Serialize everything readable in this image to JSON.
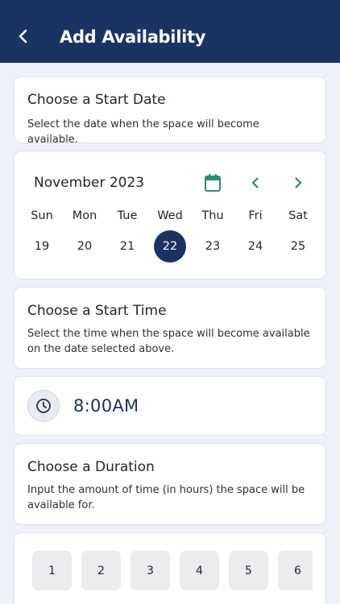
{
  "header": {
    "title": "Add Availability",
    "back_icon": "chevron-left-icon"
  },
  "start_date": {
    "title": "Choose a Start Date",
    "description": "Select the date when the space will become available."
  },
  "calendar": {
    "month_label": "November 2023",
    "calendar_icon": "calendar-icon",
    "weekdays": [
      "Sun",
      "Mon",
      "Tue",
      "Wed",
      "Thu",
      "Fri",
      "Sat"
    ],
    "days": [
      "19",
      "20",
      "21",
      "22",
      "23",
      "24",
      "25"
    ],
    "selected_day": "22",
    "accent_color": "#2e8b74",
    "selected_color": "#1b3363"
  },
  "start_time": {
    "title": "Choose a Start Time",
    "description": "Select the time when the space will become available on the date selected above.",
    "value": "8:00AM",
    "clock_icon": "clock-icon"
  },
  "duration": {
    "title": "Choose a Duration",
    "description": "Input the amount of time (in hours) the space will be available for.",
    "options": [
      "1",
      "2",
      "3",
      "4",
      "5",
      "6"
    ]
  }
}
